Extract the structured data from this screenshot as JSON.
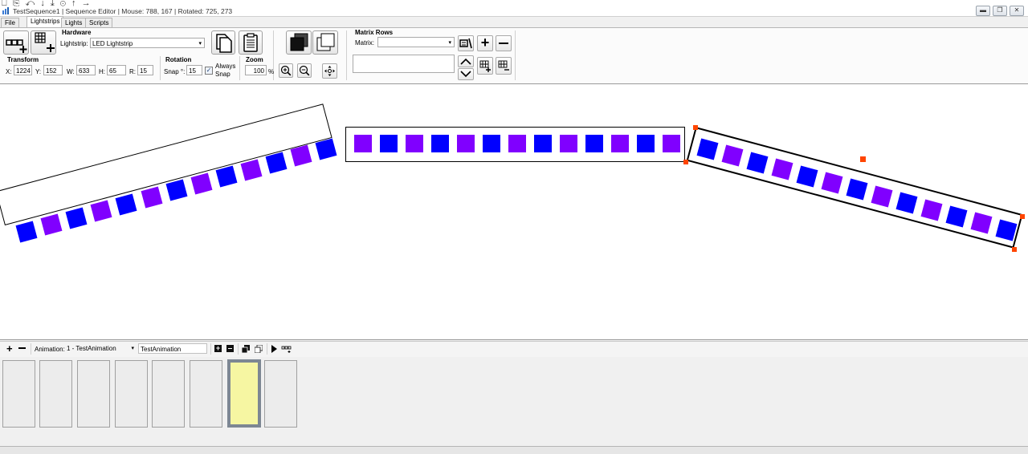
{
  "window": {
    "title": "TestSequence1 | Sequence Editor | Mouse: 788, 167 | Rotated: 725, 273",
    "quick_access": "⎕ ⎘ ↶ ↓ ⤓ ⊙ ↑ →"
  },
  "tabs": [
    "File",
    "Lightstrips",
    "Lights",
    "Scripts"
  ],
  "hardware": {
    "heading": "Hardware",
    "lightstrip_label": "Lightstrip:",
    "lightstrip_value": "LED Lightstrip"
  },
  "transform": {
    "heading": "Transform",
    "x_label": "X:",
    "x_value": "1224",
    "y_label": "Y:",
    "y_value": "152",
    "w_label": "W:",
    "w_value": "633",
    "h_label": "H:",
    "h_value": "65",
    "r_label": "R:",
    "r_value": "15"
  },
  "rotation": {
    "heading": "Rotation",
    "snap_label": "Snap °:",
    "snap_value": "15",
    "always_snap_line1": "Always",
    "always_snap_line2": "Snap",
    "always_snap_checked": true
  },
  "zoom": {
    "heading": "Zoom",
    "value": "100",
    "unit": "%"
  },
  "matrix": {
    "heading": "Matrix Rows",
    "matrix_label": "Matrix:",
    "matrix_value": ""
  },
  "animation_bar": {
    "animation_label": "Animation:",
    "animation_value": "1 - TestAnimation",
    "name_value": "TestAnimation"
  },
  "frames": {
    "count": 8,
    "selected_index": 6
  },
  "colors": {
    "led_blue": "#0000ff",
    "led_purple": "#8000ff",
    "selection_handle": "#ff4500",
    "selected_frame_fill": "#f6f6a2",
    "selected_frame_border": "#7d8793"
  },
  "strips": [
    {
      "name": "left-strip",
      "angle_deg": -15,
      "led_count": 13,
      "first_color": "blue",
      "selected": false
    },
    {
      "name": "middle-strip",
      "angle_deg": 0,
      "led_count": 13,
      "first_color": "purple",
      "selected": false
    },
    {
      "name": "right-strip",
      "angle_deg": 15,
      "led_count": 13,
      "first_color": "blue",
      "selected": true
    }
  ]
}
